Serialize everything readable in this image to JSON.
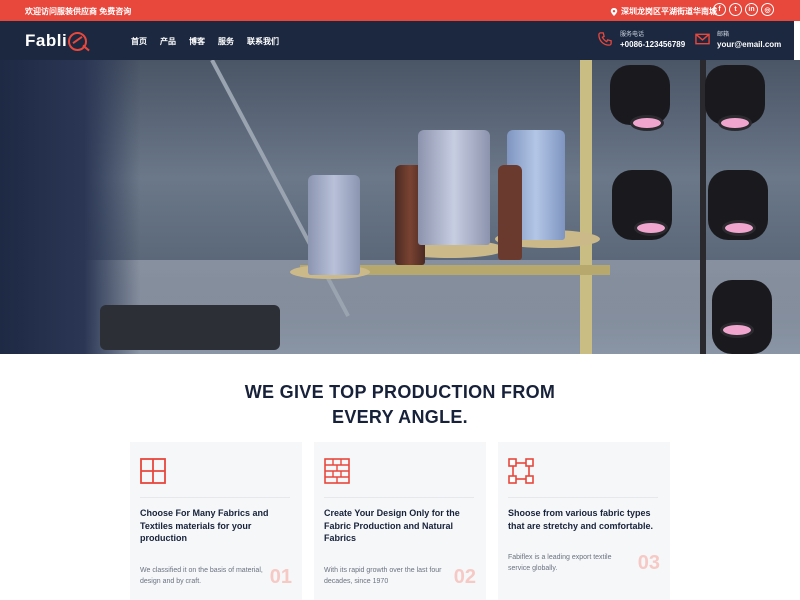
{
  "topbar": {
    "welcome": "欢迎访问服装供应商 免费咨询",
    "location": "深圳龙岗区平湖街道华南城",
    "socials": [
      {
        "icon": "facebook-icon",
        "glyph": "f"
      },
      {
        "icon": "twitter-icon",
        "glyph": "t"
      },
      {
        "icon": "linkedin-icon",
        "glyph": "in"
      },
      {
        "icon": "instagram-icon",
        "glyph": "◎"
      }
    ]
  },
  "header": {
    "logo": "Fabli",
    "nav": [
      "首页",
      "产品",
      "博客",
      "服务",
      "联系我们"
    ],
    "phone": {
      "label": "服务电话",
      "value": "+0086-123456789"
    },
    "email": {
      "label": "邮箱",
      "value": "your@email.com"
    }
  },
  "section": {
    "title_line1": "WE GIVE TOP PRODUCTION FROM",
    "title_line2": "EVERY ANGLE."
  },
  "cards": [
    {
      "icon": "grid-icon",
      "title": "Choose For Many Fabrics and Textiles materials for your production",
      "desc": "We classified it on the basis of material, design and by craft.",
      "num": "01"
    },
    {
      "icon": "brick-wall-icon",
      "title": "Create Your Design Only for the Fabric Production and Natural Fabrics",
      "desc": "With its rapid growth over the last four decades, since 1970",
      "num": "02"
    },
    {
      "icon": "vector-shape-icon",
      "title": "Shoose from various fabric types that are stretchy and comfortable.",
      "desc": "Fabiflex is a leading export textile service globally.",
      "num": "03"
    }
  ],
  "colors": {
    "accent": "#e8473c",
    "header_bg": "#1b2840",
    "card_bg": "#f6f7f9"
  }
}
